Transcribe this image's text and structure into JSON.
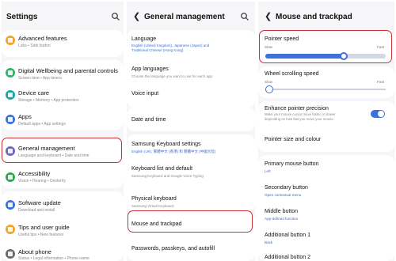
{
  "settings": {
    "title": "Settings",
    "items": [
      {
        "title": "Advanced features",
        "sub": "Labs • Side button",
        "color": "#f0a52a"
      },
      {
        "title": "Digital Wellbeing and parental controls",
        "sub": "Screen time • App timers",
        "color": "#34b36a"
      },
      {
        "title": "Device care",
        "sub": "Storage • Memory • App protection",
        "color": "#1aa6a6"
      },
      {
        "title": "Apps",
        "sub": "Default apps • App settings",
        "color": "#3b73d9"
      },
      {
        "title": "General management",
        "sub": "Language and keyboard • Date and time",
        "color": "#6c64c6"
      },
      {
        "title": "Accessibility",
        "sub": "Vision • Hearing • Dexterity",
        "color": "#2fa84f"
      },
      {
        "title": "Software update",
        "sub": "Download and install",
        "color": "#3b73d9"
      },
      {
        "title": "Tips and user guide",
        "sub": "Useful tips • New features",
        "color": "#f0a52a"
      },
      {
        "title": "About phone",
        "sub": "Status • Legal information • Phone name",
        "color": "#6b6b6b"
      }
    ]
  },
  "general": {
    "title": "General management",
    "language": {
      "title": "Language",
      "sub1": "English (United Kingdom), Japanese (Japan) and",
      "sub2": "Traditional Chinese (Hong Kong)"
    },
    "app_languages": {
      "title": "App languages",
      "sub": "Choose the language you want to use for each app."
    },
    "voice_input": "Voice input",
    "date_time": "Date and time",
    "samsung_keyboard": {
      "title": "Samsung Keyboard settings",
      "sub": "English (UK), 繁體中文 (香港) 和 簡體中文 (中國大陸)"
    },
    "keyboard_list": {
      "title": "Keyboard list and default",
      "sub": "Samsung Keyboard and Google Voice Typing"
    },
    "physical_keyboard": {
      "title": "Physical keyboard",
      "sub": "Samsung Virtual Keyboard"
    },
    "mouse_trackpad": "Mouse and trackpad",
    "passwords": "Passwords, passkeys, and autofill"
  },
  "mouse": {
    "title": "Mouse and trackpad",
    "pointer_speed": {
      "title": "Pointer speed",
      "slow": "Slow",
      "fast": "Fast",
      "level": 0.65
    },
    "wheel_speed": {
      "title": "Wheel scrolling speed",
      "slow": "Slow",
      "fast": "Fast",
      "level": 0.0
    },
    "enhance": {
      "title": "Enhance pointer precision",
      "desc1": "Make your mouse cursor move faster or slower",
      "desc2": "depending on how fast you move your mouse.",
      "on": true
    },
    "pointer_size": "Pointer size and colour",
    "primary": {
      "title": "Primary mouse button",
      "value": "Left"
    },
    "secondary": {
      "title": "Secondary button",
      "value": "Open contextual menu"
    },
    "middle": {
      "title": "Middle button",
      "value": "App-defined function"
    },
    "additional1": {
      "title": "Additional button 1",
      "value": "Back"
    },
    "additional2": {
      "title": "Additional button 2"
    }
  },
  "colors": {
    "accent": "#3b73d9",
    "highlight": "#c4323a"
  }
}
